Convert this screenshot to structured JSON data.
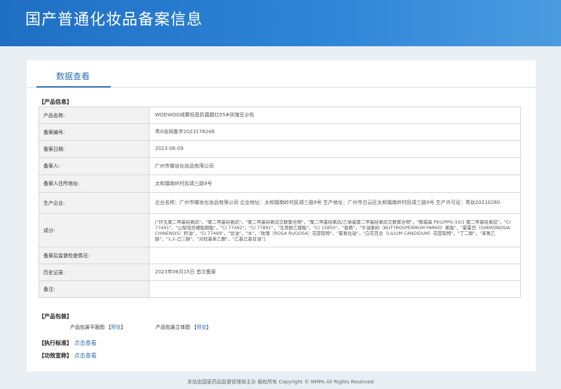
{
  "header": {
    "title": "国产普通化妆品备案信息"
  },
  "tabs": [
    {
      "label": "数据查看"
    }
  ],
  "product_info": {
    "section_title": "【产品信息】",
    "rows": [
      {
        "label": "产品名称:",
        "value": "WODWOD绒雾轻盈奶霜腮红05#玫瑰豆沙色"
      },
      {
        "label": "备案编号:",
        "value": "粤G妆网备字2023178246"
      },
      {
        "label": "备案日期:",
        "value": "2023-06-09"
      },
      {
        "label": "备案人:",
        "value": "广州市蝶妆化妆品有限公司"
      },
      {
        "label": "备案人住所地址:",
        "value": "太和镇南岭村民靖三路9号"
      },
      {
        "label": "生产企业:",
        "value": "企业名称：广州市蝶妆化妆品有限公司 企业地址：太和镇南岭村民靖三路9号 生产地址：广州市白云区太和镇南岭村民靖三路9号 生产许可证：粤妆20210260"
      },
      {
        "label": "成分:",
        "value": "[\"环五聚二甲基硅氧烷\"，\"聚二甲基硅氧烷\"，\"聚二甲基硅氧烷交联聚合物\"，\"聚二甲基硅氧烷/乙烯基聚二甲基硅氧烷交联聚合物\"，\"鲸蜡基 PEG/PPG-10/1 聚二甲基硅氧烷\"，\"CI 77491\"，\"山梨坦异硬脂酸酯\"，\"CI 77492\"，\"CI 77891\"，\"生育酚乙酸酯\"，\"CI 15850\"，\"香精\"，\"牛油果树（BUTYROSPERMUM PARKII）果脂\"，\"霍霍巴（SIMMONDSIA CHINENSIS）籽油\"，\"CI 77499\"，\"甘油\"，\"水\"，\"玫瑰（ROSA RUGOSA）花提取物\"，\"氯氧化铋\"，\"白花百合（LILIUM CANDIDUM）花提取物\"，\"丁二醇\"，\"苯氧乙醇\"，\"1,2-己二醇\"，\"对羟基苯乙酮\"，\"乙基己基甘油\"]"
      },
      {
        "label": "备案后监督检查情况:",
        "value": ""
      },
      {
        "label": "历史记录:",
        "value": "2023年06月15日 首次备案"
      },
      {
        "label": "备注:",
        "value": ""
      }
    ]
  },
  "packaging": {
    "section_title": "【产品包装】",
    "flat_label": "产品包装平面图",
    "stereo_label": "产品包装立体图",
    "preview_link": "预览"
  },
  "standard": {
    "section_title": "【执行标准】",
    "link": "点击查看"
  },
  "efficacy": {
    "section_title": "【功效宣称】",
    "link": "点击查看"
  },
  "footer": {
    "text": "本站由国家药品监督管理局主办 版权所有 Copyright © NMPA All Rights Reserved"
  }
}
